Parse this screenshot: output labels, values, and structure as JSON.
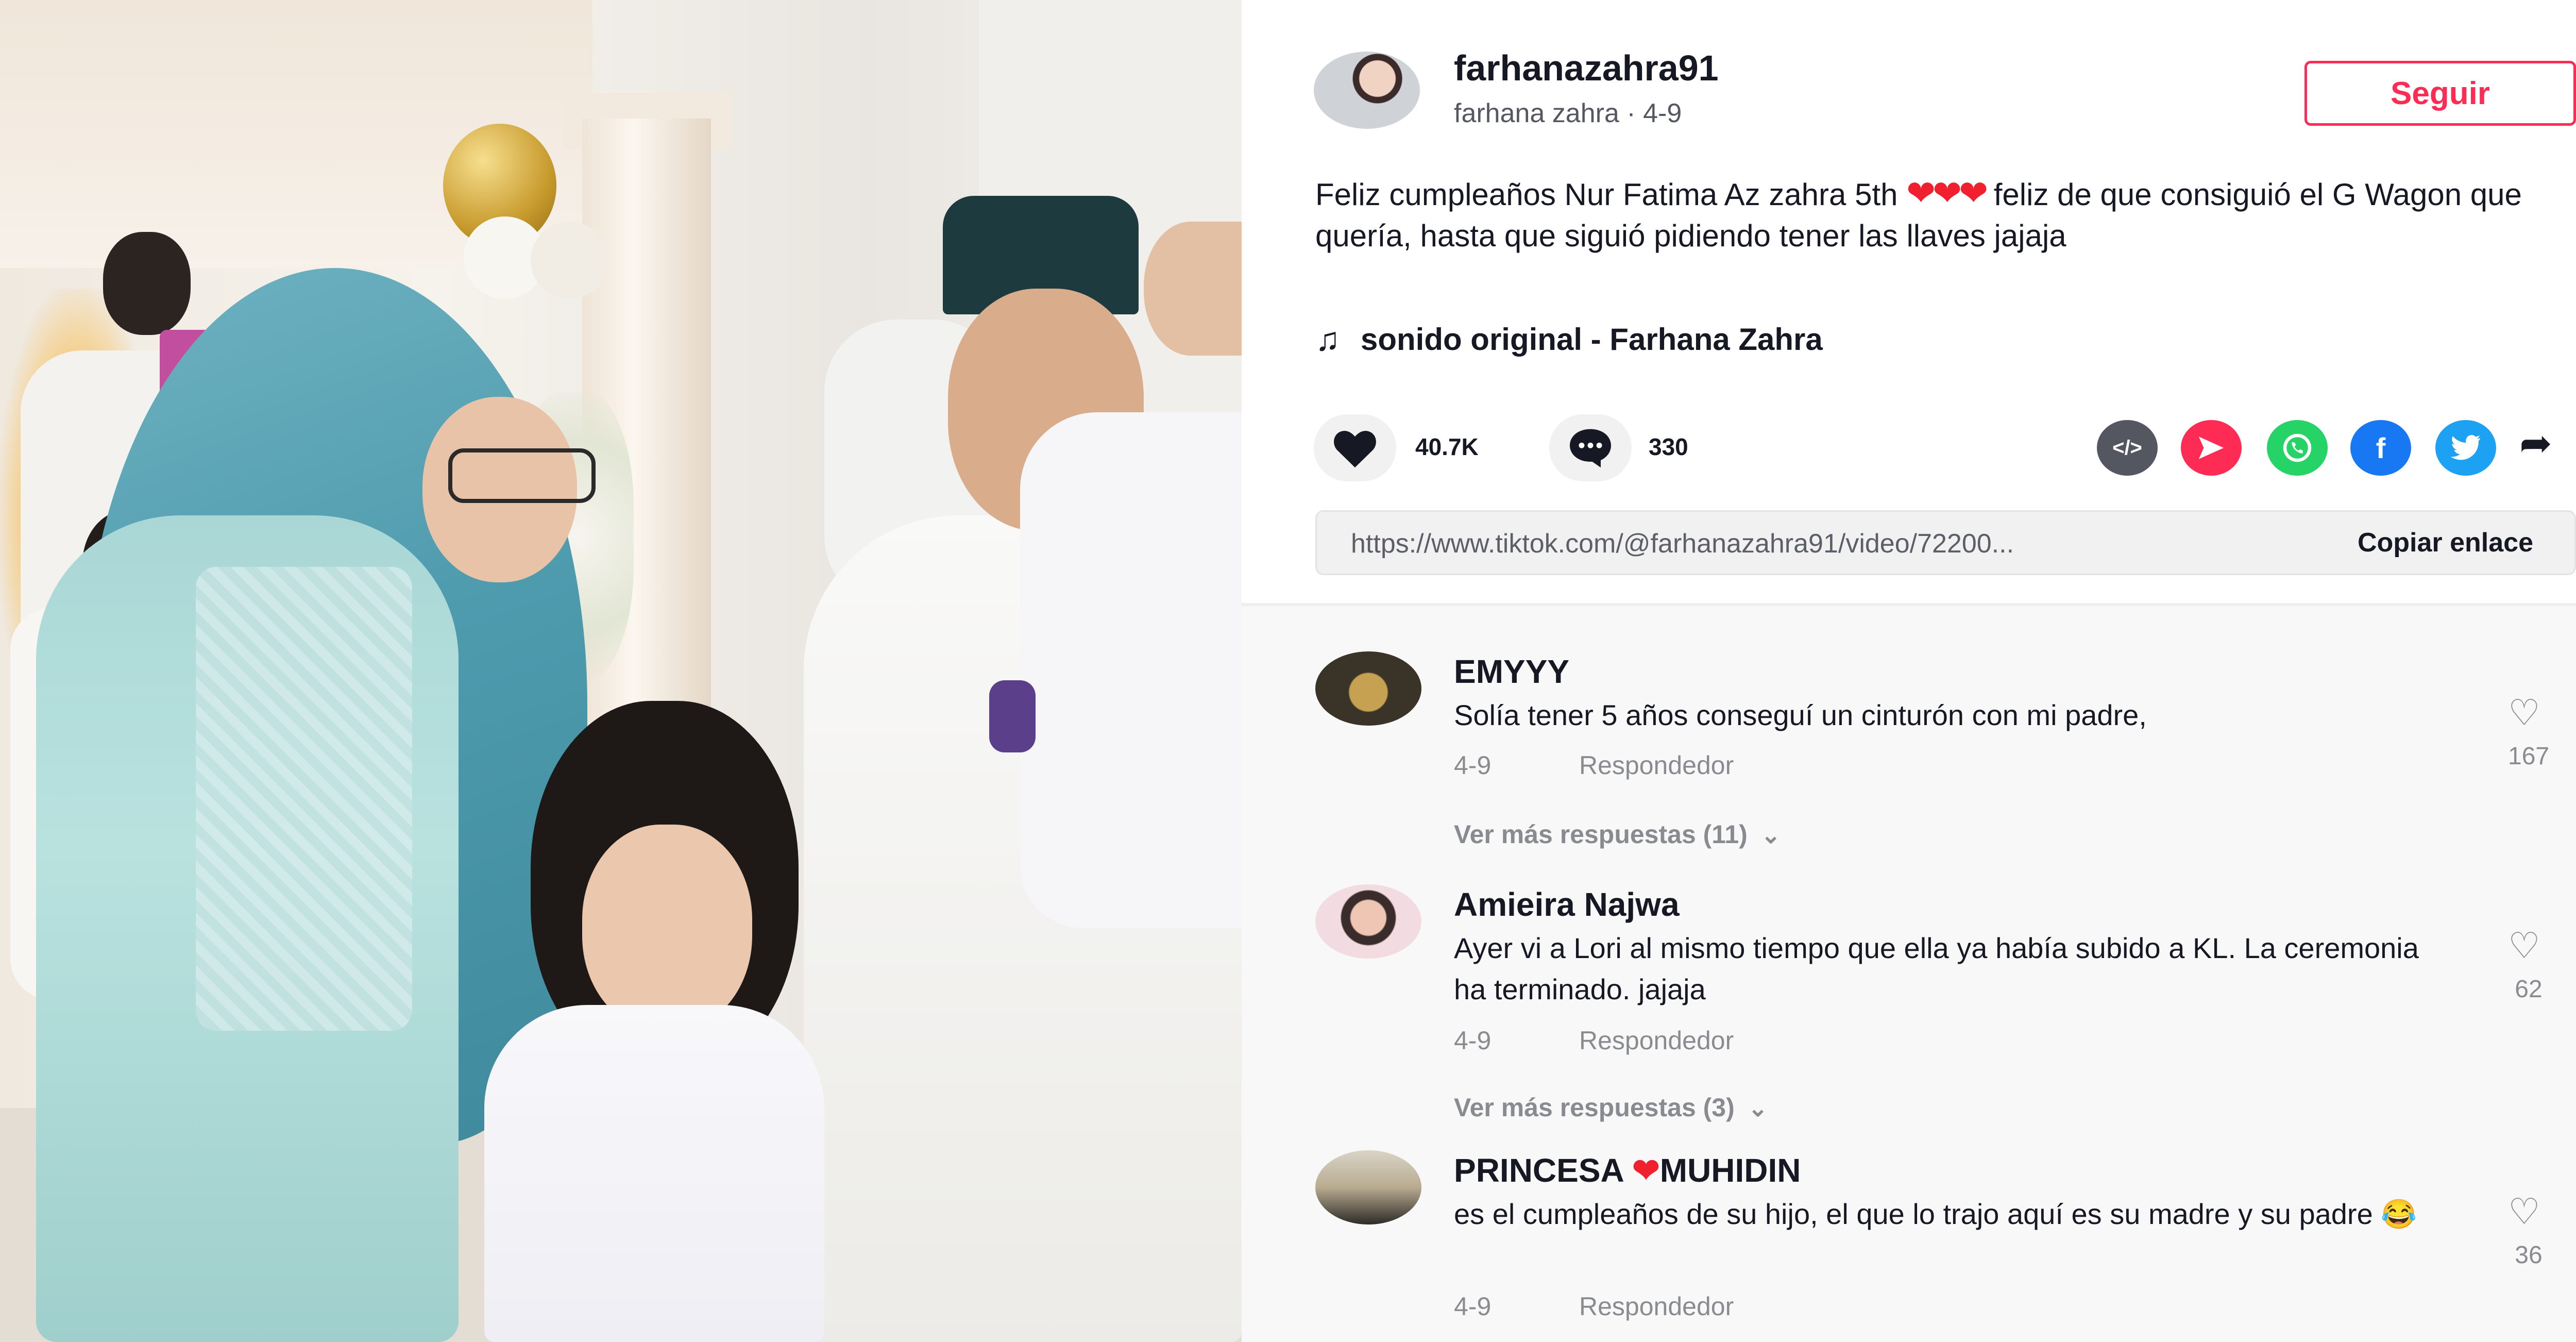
{
  "post": {
    "username": "farhanazahra91",
    "display_name_date": "farhana zahra · 4-9",
    "follow_label": "Seguir",
    "caption_part1": "Feliz cumpleaños Nur Fatima Az zahra 5th ",
    "caption_hearts": "❤❤❤",
    "caption_part2": " feliz de que consiguió el G Wagon que quería, hasta que siguió pidiendo tener las llaves jajaja",
    "music_label": "sonido original - Farhana Zahra",
    "likes": "40.7K",
    "comments_count": "330",
    "link_url": "https://www.tiktok.com/@farhanazahra91/video/72200...",
    "copy_link_label": "Copiar enlace"
  },
  "icons": {
    "heart": "heart-icon",
    "comment": "comment-bubble-icon",
    "embed": "embed-code-icon",
    "send": "send-icon",
    "whatsapp": "whatsapp-icon",
    "facebook": "facebook-icon",
    "twitter": "twitter-icon",
    "share": "share-arrow-icon",
    "music": "music-note-icon"
  },
  "colors": {
    "accent": "#fe2c55",
    "whatsapp": "#25d366",
    "facebook": "#1877f2",
    "twitter": "#1da1f2"
  },
  "comments": [
    {
      "username": "EMYYY",
      "text": "Solía tener 5 años conseguí un cinturón con mi padre,",
      "date": "4-9",
      "reply_label": "Respondedor",
      "likes": "167",
      "more_replies": "Ver más respuestas (11)"
    },
    {
      "username": "Amieira Najwa",
      "text": "Ayer vi a Lori al mismo tiempo que ella ya había subido a KL. La ceremonia ha terminado. jajaja",
      "date": "4-9",
      "reply_label": "Respondedor",
      "likes": "62",
      "more_replies": "Ver más respuestas (3)"
    },
    {
      "username_part1": "PRINCESA ",
      "username_heart": "❤",
      "username_part2": "MUHIDIN",
      "text": "es el cumpleaños de su hijo, el que lo trajo aquí es su madre y su padre 😂",
      "date": "4-9",
      "reply_label": "Respondedor",
      "likes": "36"
    }
  ]
}
